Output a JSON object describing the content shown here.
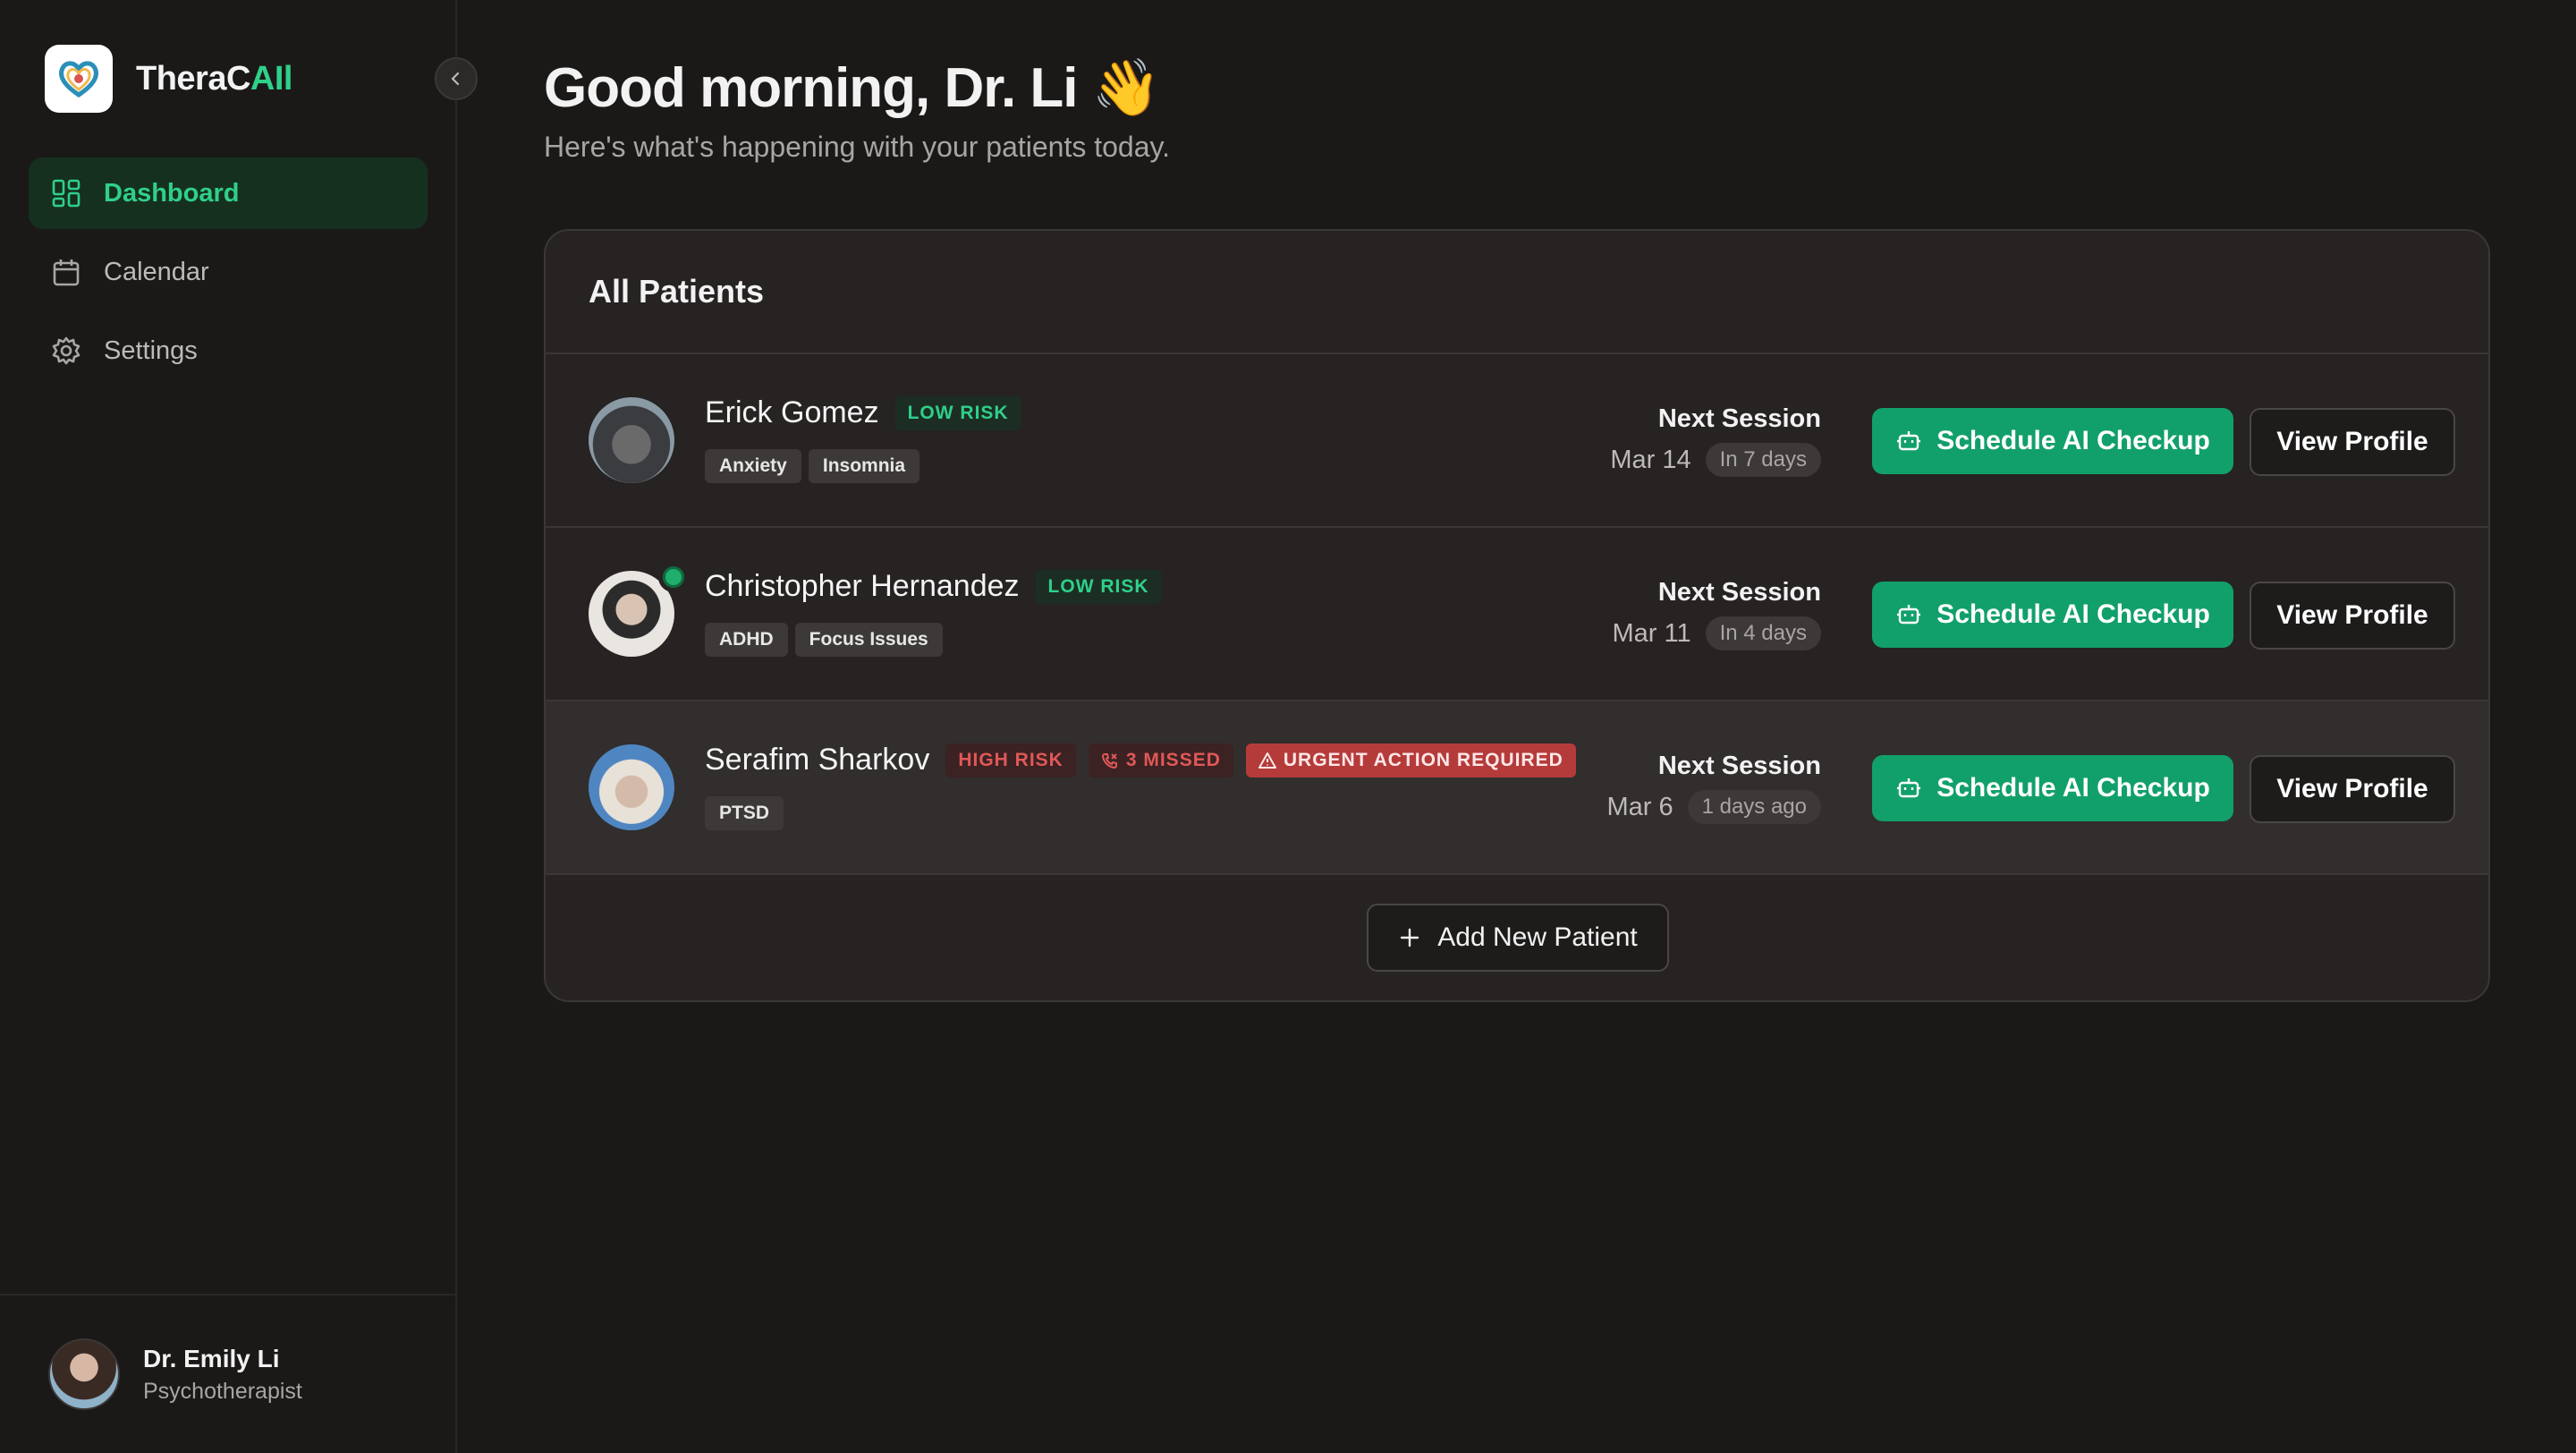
{
  "brand": {
    "name_prefix": "TheraC",
    "name_suffix": "AIl"
  },
  "nav": [
    {
      "label": "Dashboard",
      "icon": "dashboard-icon",
      "active": true
    },
    {
      "label": "Calendar",
      "icon": "calendar-icon",
      "active": false
    },
    {
      "label": "Settings",
      "icon": "gear-icon",
      "active": false
    }
  ],
  "user": {
    "name": "Dr. Emily Li",
    "role": "Psychotherapist"
  },
  "greeting": "Good morning, Dr. Li 👋",
  "subtitle": "Here's what's happening with your patients today.",
  "panel": {
    "title": "All Patients"
  },
  "patients": [
    {
      "name": "Erick Gomez",
      "risk": "LOW RISK",
      "tags": [
        "Anxiety",
        "Insomnia"
      ],
      "session_label": "Next Session",
      "session_date": "Mar 14",
      "session_relative": "In 7 days"
    },
    {
      "name": "Christopher Hernandez",
      "risk": "LOW RISK",
      "tags": [
        "ADHD",
        "Focus Issues"
      ],
      "session_label": "Next Session",
      "session_date": "Mar 11",
      "session_relative": "In 4 days"
    },
    {
      "name": "Serafim Sharkov",
      "risk": "HIGH RISK",
      "missed": "3 MISSED",
      "urgent": "URGENT ACTION REQUIRED",
      "tags": [
        "PTSD"
      ],
      "session_label": "Next Session",
      "session_date": "Mar 6",
      "session_relative": "1 days ago"
    }
  ],
  "actions": {
    "schedule": "Schedule AI Checkup",
    "view": "View Profile",
    "add": "Add New Patient"
  },
  "colors": {
    "accent": "#2fd08a",
    "primary_button": "#12a06a",
    "danger": "#e15858",
    "background": "#1b1918"
  }
}
